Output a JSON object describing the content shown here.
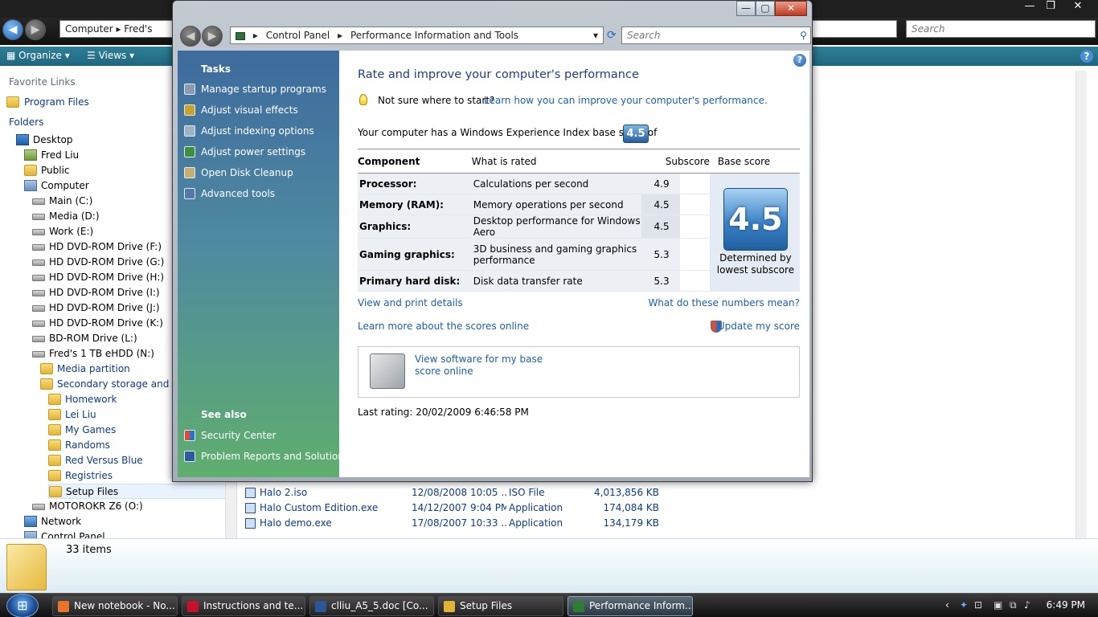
{
  "explorer": {
    "address": "Computer ▸ Fred's",
    "search_placeholder": "Search",
    "toolbar": {
      "organize": "Organize",
      "views": "Views"
    },
    "favorite_links_label": "Favorite Links",
    "favorites": [
      "Program Files"
    ],
    "folders_label": "Folders",
    "tree": [
      {
        "label": "Desktop",
        "icon": "desktop-icon",
        "indent": 0
      },
      {
        "label": "Fred Liu",
        "icon": "user-folder-icon",
        "indent": 1
      },
      {
        "label": "Public",
        "icon": "folder-icon",
        "indent": 1
      },
      {
        "label": "Computer",
        "icon": "computer-icon",
        "indent": 1
      },
      {
        "label": "Main (C:)",
        "icon": "drive-icon",
        "indent": 2
      },
      {
        "label": "Media (D:)",
        "icon": "drive-icon",
        "indent": 2
      },
      {
        "label": "Work (E:)",
        "icon": "drive-icon",
        "indent": 2
      },
      {
        "label": "HD DVD-ROM Drive (F:)",
        "icon": "dvd-drive-icon",
        "indent": 2
      },
      {
        "label": "HD DVD-ROM Drive (G:)",
        "icon": "dvd-drive-icon",
        "indent": 2
      },
      {
        "label": "HD DVD-ROM Drive (H:)",
        "icon": "dvd-drive-icon",
        "indent": 2
      },
      {
        "label": "HD DVD-ROM Drive (I:)",
        "icon": "dvd-drive-icon",
        "indent": 2
      },
      {
        "label": "HD DVD-ROM Drive (J:)",
        "icon": "dvd-drive-icon",
        "indent": 2
      },
      {
        "label": "HD DVD-ROM Drive (K:)",
        "icon": "dvd-drive-icon",
        "indent": 2
      },
      {
        "label": "BD-ROM Drive (L:)",
        "icon": "dvd-drive-icon",
        "indent": 2
      },
      {
        "label": "Fred's 1 TB eHDD (N:)",
        "icon": "drive-icon",
        "indent": 2
      },
      {
        "label": "Media partition",
        "icon": "folder-icon",
        "indent": 3
      },
      {
        "label": "Secondary storage and bac",
        "icon": "folder-icon",
        "indent": 3
      },
      {
        "label": "Homework",
        "icon": "folder-icon",
        "indent": 4
      },
      {
        "label": "Lei Liu",
        "icon": "folder-icon",
        "indent": 4
      },
      {
        "label": "My Games",
        "icon": "folder-icon",
        "indent": 4
      },
      {
        "label": "Randoms",
        "icon": "folder-icon",
        "indent": 4
      },
      {
        "label": "Red Versus Blue",
        "icon": "folder-icon",
        "indent": 4
      },
      {
        "label": "Registries",
        "icon": "folder-icon",
        "indent": 4
      },
      {
        "label": "Setup Files",
        "icon": "folder-icon",
        "indent": 4
      },
      {
        "label": "MOTOROKR Z6 (O:)",
        "icon": "phone-icon",
        "indent": 2
      },
      {
        "label": "Network",
        "icon": "network-icon",
        "indent": 1
      },
      {
        "label": "Control Panel",
        "icon": "control-panel-icon",
        "indent": 1
      }
    ],
    "files": [
      {
        "name": "Halo 2.iso",
        "date": "12/08/2008 10:05 ...",
        "type": "ISO File",
        "size": "4,013,856 KB"
      },
      {
        "name": "Halo Custom Edition.exe",
        "date": "14/12/2007 9:04 PM",
        "type": "Application",
        "size": "174,084 KB"
      },
      {
        "name": "Halo demo.exe",
        "date": "17/08/2007 10:33 ...",
        "type": "Application",
        "size": "134,179 KB"
      }
    ],
    "items_count": "33 items"
  },
  "perf": {
    "breadcrumb": [
      "Control Panel",
      "Performance Information and Tools"
    ],
    "search_placeholder": "Search",
    "tasks_heading": "Tasks",
    "tasks": [
      {
        "label": "Manage startup programs",
        "icon": "startup-programs-icon"
      },
      {
        "label": "Adjust visual effects",
        "icon": "visual-effects-shield-icon"
      },
      {
        "label": "Adjust indexing options",
        "icon": "indexing-icon"
      },
      {
        "label": "Adjust power settings",
        "icon": "power-icon"
      },
      {
        "label": "Open Disk Cleanup",
        "icon": "disk-cleanup-icon"
      },
      {
        "label": "Advanced tools",
        "icon": "advanced-tools-icon"
      }
    ],
    "see_also_heading": "See also",
    "see_also": [
      {
        "label": "Security Center",
        "icon": "security-center-icon"
      },
      {
        "label": "Problem Reports and Solutions",
        "icon": "problem-reports-icon"
      }
    ],
    "title": "Rate and improve your computer's performance",
    "hint_text": "Not sure where to start?",
    "hint_link": "Learn how you can improve your computer's performance.",
    "base_line": "Your computer has a Windows Experience Index base score of",
    "base_score": "4.5",
    "table": {
      "headers": [
        "Component",
        "What is rated",
        "Subscore",
        "Base score"
      ],
      "rows": [
        {
          "component": "Processor:",
          "what": "Calculations per second",
          "subscore": "4.9"
        },
        {
          "component": "Memory (RAM):",
          "what": "Memory operations per second",
          "subscore": "4.5"
        },
        {
          "component": "Graphics:",
          "what": "Desktop performance for Windows Aero",
          "subscore": "4.5"
        },
        {
          "component": "Gaming graphics:",
          "what": "3D business and gaming graphics performance",
          "subscore": "5.3"
        },
        {
          "component": "Primary hard disk:",
          "what": "Disk data transfer rate",
          "subscore": "5.3"
        }
      ],
      "base_caption": "Determined by lowest subscore"
    },
    "links": {
      "view_print": "View and print details",
      "what_numbers": "What do these numbers mean?",
      "learn_more": "Learn more about the scores online",
      "update_score": "Update my score",
      "view_software": "View software for my base score online"
    },
    "last_rating": "Last rating: 20/02/2009 6:46:58 PM"
  },
  "taskbar": {
    "start_label": "Start",
    "buttons": [
      {
        "label": "New notebook - No...",
        "color": "#e8742c",
        "active": false
      },
      {
        "label": "Instructions and te...",
        "color": "#c8102e",
        "active": false
      },
      {
        "label": "clliu_A5_5.doc [Co...",
        "color": "#2b579a",
        "active": false
      },
      {
        "label": "Setup Files",
        "color": "#e2b436",
        "active": false
      },
      {
        "label": "Performance Inform...",
        "color": "#2e7d32",
        "active": true
      }
    ],
    "clock": "6:49 PM"
  }
}
